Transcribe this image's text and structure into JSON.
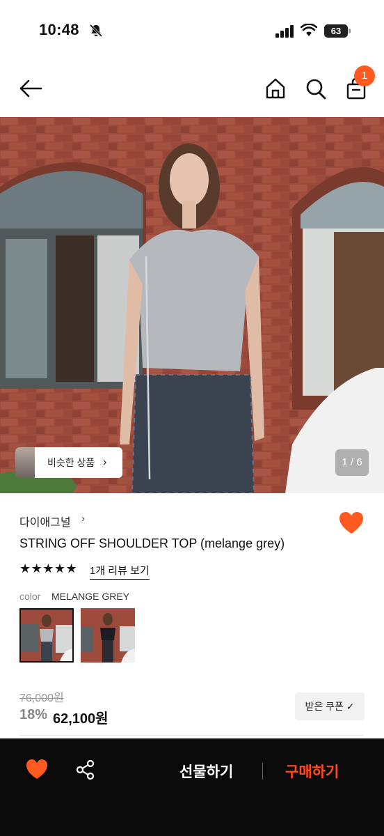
{
  "status_bar": {
    "time": "10:48",
    "battery": "63"
  },
  "nav": {
    "cart_count": "1"
  },
  "hero": {
    "similar_label": "비슷한 상품",
    "similar_chevron": "›",
    "counter": "1 / 6"
  },
  "product": {
    "brand": "다이애그널",
    "brand_chevron": "›",
    "title": "STRING OFF SHOULDER TOP (melange grey)",
    "stars": "★★★★★",
    "rating_stars": 5,
    "review_link": "1개 리뷰 보기",
    "color_label": "color",
    "color_value": "MELANGE GREY",
    "swatches": [
      "melange grey",
      "black"
    ],
    "original_price": "76,000원",
    "discount": "18%",
    "price": "62,100원",
    "coupon": "받은 쿠폰 ✓"
  },
  "bottom_bar": {
    "gift_label": "선물하기",
    "buy_label": "구매하기"
  },
  "colors": {
    "accent": "#ff5a1f",
    "buy": "#ff4b1f",
    "bar": "#0a0a0a"
  }
}
